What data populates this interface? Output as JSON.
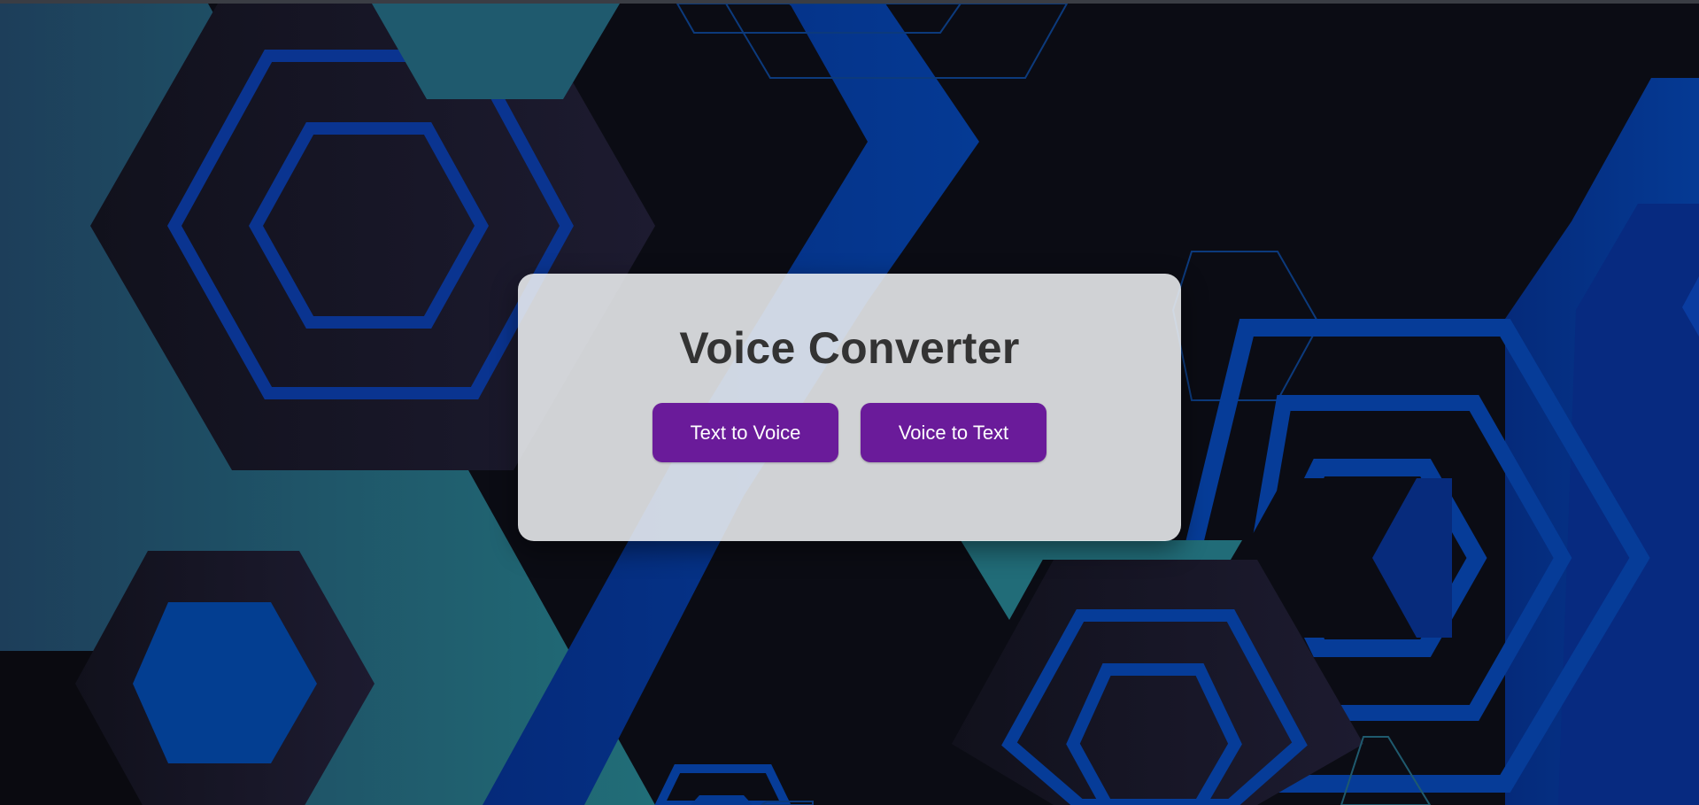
{
  "app": {
    "title": "Voice Converter"
  },
  "actions": {
    "text_to_voice_label": "Text to Voice",
    "voice_to_text_label": "Voice to Text"
  },
  "theme": {
    "background": "#0b0c14",
    "button": "#6a1b9a",
    "card": "#ecedf0",
    "title_text": "#333333",
    "hex_dark": "#181828",
    "hex_blue": "#05399a",
    "hex_teal": "#1f6875"
  }
}
